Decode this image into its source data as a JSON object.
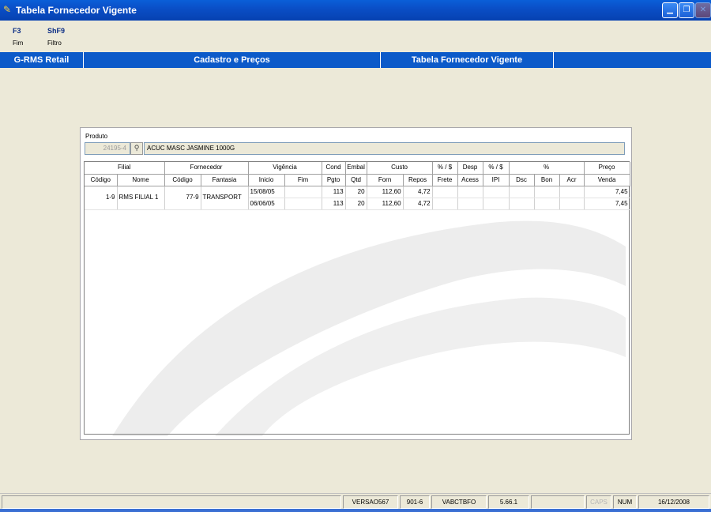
{
  "window": {
    "title": "Tabela Fornecedor Vigente",
    "icon": "app-icon",
    "controls": [
      "minimize-icon",
      "restore-icon",
      "close-icon"
    ]
  },
  "function_keys": [
    {
      "key": "F3",
      "label": "Fim"
    },
    {
      "key": "ShF9",
      "label": "Filtro"
    }
  ],
  "header_band": {
    "app": "G-RMS Retail",
    "module": "Cadastro e Preços",
    "screen": "Tabela Fornecedor Vigente"
  },
  "produto": {
    "label": "Produto",
    "code": "24195-4",
    "description": "ACUC MASC JASMINE 1000G",
    "search_icon": "binoculars-icon"
  },
  "table": {
    "group_headers": [
      "Filial",
      "Fornecedor",
      "Vigência",
      "Cond",
      "Embal",
      "Custo",
      "% / $",
      "Desp",
      "% / $",
      "%",
      "Preço"
    ],
    "columns": [
      "Código",
      "Nome",
      "Código",
      "Fantasia",
      "Inicio",
      "Fim",
      "Pgto",
      "Qtd",
      "Forn",
      "Repos",
      "Frete",
      "Acess",
      "IPI",
      "Dsc",
      "Bon",
      "Acr",
      "Venda"
    ],
    "shared": {
      "filial_codigo": "1-9",
      "filial_nome": "RMS FILIAL 1",
      "forn_codigo": "77-9",
      "forn_fantasia": "TRANSPORT"
    },
    "rows": [
      {
        "inicio": "15/08/05",
        "fim": "",
        "pgto": "113",
        "qtd": "20",
        "forn": "112,60",
        "repos": "4,72",
        "frete": "",
        "acess": "",
        "ipi": "",
        "dsc": "",
        "bon": "",
        "acr": "",
        "venda": "7,45"
      },
      {
        "inicio": "06/06/05",
        "fim": "",
        "pgto": "113",
        "qtd": "20",
        "forn": "112,60",
        "repos": "4,72",
        "frete": "",
        "acess": "",
        "ipi": "",
        "dsc": "",
        "bon": "",
        "acr": "",
        "venda": "7,45"
      }
    ]
  },
  "statusbar": {
    "message": "",
    "version": "VERSAO567",
    "store": "901-6",
    "user": "VABCTBFO",
    "build": "5.66.1",
    "empty": "",
    "caps": "CAPS",
    "num": "NUM",
    "date": "16/12/2008"
  },
  "colors": {
    "titlebar": "#0a4fc7",
    "header_band": "#0c5ac9",
    "background": "#ece9d8",
    "fkey": "#0c2e85"
  }
}
